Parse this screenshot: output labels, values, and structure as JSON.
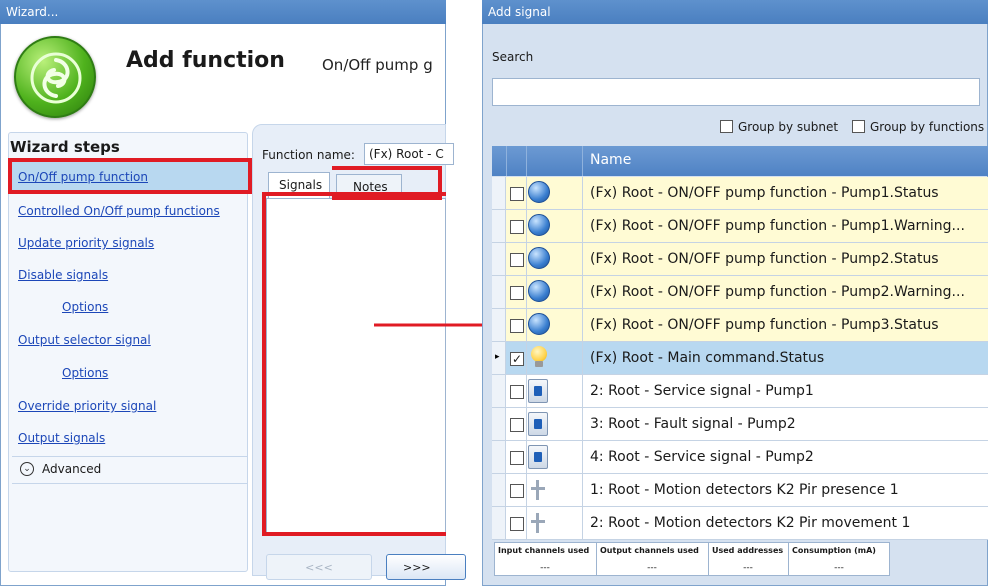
{
  "wizard": {
    "window_title": "Wizard...",
    "heading": "Add function",
    "subheading": "On/Off pump g",
    "steps_title": "Wizard steps",
    "steps": [
      {
        "label": "On/Off pump function"
      },
      {
        "label": "Controlled On/Off pump functions"
      },
      {
        "label": "Update priority signals"
      },
      {
        "label": "Disable signals"
      },
      {
        "label": "Options"
      },
      {
        "label": "Output selector signal"
      },
      {
        "label": "Options"
      },
      {
        "label": "Override priority signal"
      },
      {
        "label": "Output signals"
      }
    ],
    "advanced_label": "Advanced",
    "function_name_label": "Function name:",
    "function_name_value": "(Fx) Root - C",
    "tabs": [
      {
        "label": "Signals"
      },
      {
        "label": "Notes"
      }
    ],
    "back_label": "<<<",
    "next_label": ">>>"
  },
  "add_signal": {
    "window_title": "Add signal",
    "search_label": "Search",
    "search_value": "",
    "group_by_subnet_label": "Group by subnet",
    "group_by_functions_label": "Group by functions",
    "name_header": "Name",
    "rows": [
      {
        "name": "(Fx) Root - ON/OFF pump function - Pump1.Status",
        "checked": "",
        "icon": "function-icon",
        "selected": false
      },
      {
        "name": "(Fx) Root - ON/OFF pump function - Pump1.Warning...",
        "checked": "",
        "icon": "function-icon",
        "selected": false
      },
      {
        "name": "(Fx) Root - ON/OFF pump function - Pump2.Status",
        "checked": "",
        "icon": "function-icon",
        "selected": false
      },
      {
        "name": "(Fx) Root - ON/OFF pump function - Pump2.Warning...",
        "checked": "",
        "icon": "function-icon",
        "selected": false
      },
      {
        "name": "(Fx) Root - ON/OFF pump function - Pump3.Status",
        "checked": "",
        "icon": "function-icon",
        "selected": false
      },
      {
        "name": "(Fx) Root - Main command.Status",
        "checked": "✓",
        "icon": "light-bulb-icon",
        "selected": true
      },
      {
        "name": "2: Root - Service signal - Pump1",
        "checked": "",
        "icon": "switch-icon",
        "selected": false
      },
      {
        "name": "3: Root - Fault signal - Pump2",
        "checked": "",
        "icon": "switch-icon",
        "selected": false
      },
      {
        "name": "4: Root - Service signal - Pump2",
        "checked": "",
        "icon": "switch-icon",
        "selected": false
      },
      {
        "name": "1: Root - Motion detectors K2 Pir presence 1",
        "checked": "",
        "icon": "motion-detector-icon",
        "selected": false
      },
      {
        "name": "2: Root - Motion detectors K2 Pir movement 1",
        "checked": "",
        "icon": "motion-detector-icon",
        "selected": false
      }
    ],
    "stats": [
      {
        "header": "Input channels used",
        "value": "---"
      },
      {
        "header": "Output channels used",
        "value": "---"
      },
      {
        "header": "Used addresses",
        "value": "---"
      },
      {
        "header": "Consumption (mA)",
        "value": "---"
      }
    ]
  },
  "colors": {
    "highlight_red": "#e01b24",
    "title_blue": "#4a7fc0",
    "row_yellow": "#fffbd4",
    "row_selected": "#b8d8f0",
    "row_white": "#ffffff"
  }
}
